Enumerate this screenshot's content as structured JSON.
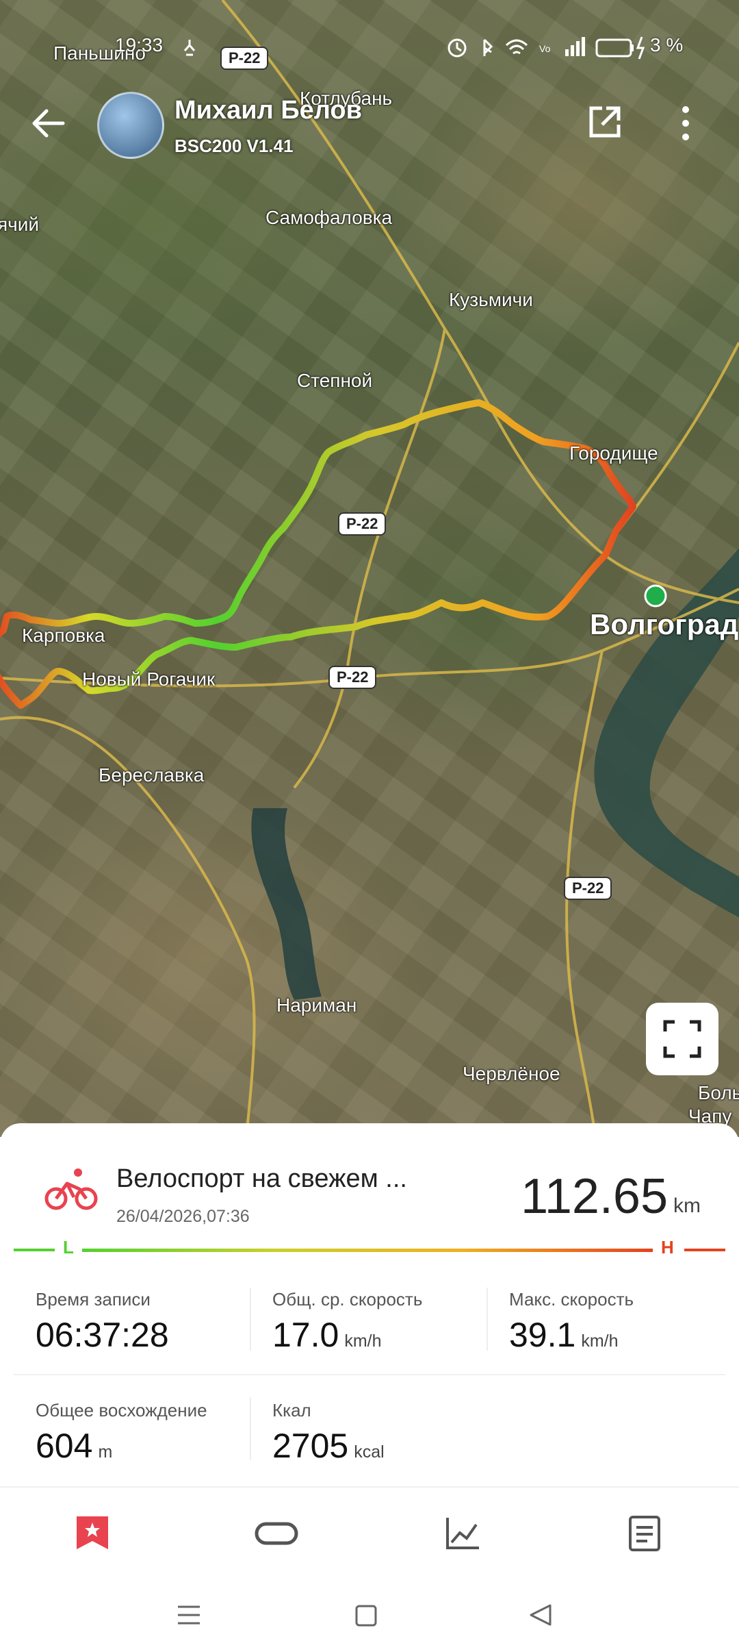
{
  "status_bar": {
    "time": "19:33",
    "battery": "3 %"
  },
  "header": {
    "name": "Михаил Белов",
    "device": "BSC200  V1.41"
  },
  "map": {
    "places": [
      {
        "text": "Паньшино"
      },
      {
        "text": "Котлубань"
      },
      {
        "text": "ячий"
      },
      {
        "text": "Самофаловка"
      },
      {
        "text": "Кузьмичи"
      },
      {
        "text": "Степной"
      },
      {
        "text": "Городище"
      },
      {
        "text": "Волгоград"
      },
      {
        "text": "Карповка"
      },
      {
        "text": "Новый Рогачик"
      },
      {
        "text": "Береславка"
      },
      {
        "text": "Нариман"
      },
      {
        "text": "Червлёное"
      },
      {
        "text": "Боль"
      },
      {
        "text": "Чапу"
      }
    ],
    "roads": [
      "Р-22",
      "Р-22",
      "Р-22",
      "Р-22"
    ]
  },
  "activity": {
    "title": "Велоспорт на свежем ...",
    "date": "26/04/2026,07:36",
    "distance": "112.65",
    "distance_unit": "km",
    "legend_low": "L",
    "legend_high": "H"
  },
  "metrics": [
    {
      "label": "Время записи",
      "value": "06:37:28",
      "unit": ""
    },
    {
      "label": "Общ. ср. скорость",
      "value": "17.0",
      "unit": "km/h"
    },
    {
      "label": "Макс. скорость",
      "value": "39.1",
      "unit": "km/h"
    },
    {
      "label": "Общее восхождение",
      "value": "604",
      "unit": "m"
    },
    {
      "label": "Ккал",
      "value": "2705",
      "unit": "kcal"
    }
  ],
  "colors": {
    "accent": "#e8434f",
    "track_low": "#53d12f",
    "track_high": "#e2431f",
    "start_dot": "#1fae4a"
  },
  "icons": [
    "back-arrow-icon",
    "share-icon",
    "more-icon",
    "fullscreen-icon",
    "cycling-icon",
    "favorite-tab-icon",
    "device-tab-icon",
    "chart-tab-icon",
    "details-tab-icon",
    "menu-icon",
    "home-icon",
    "back-nav-icon"
  ]
}
